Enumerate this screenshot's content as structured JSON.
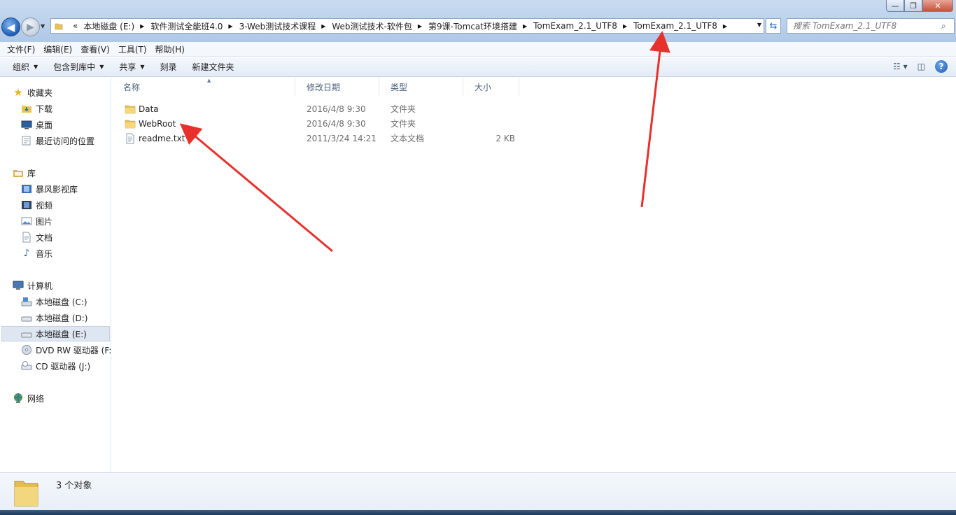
{
  "window": {
    "minimize": "—",
    "maximize": "❐",
    "close": "✕"
  },
  "address": {
    "overflow": "«",
    "crumbs": [
      "本地磁盘 (E:)",
      "软件测试全能班4.0",
      "3-Web测试技术课程",
      "Web测试技术-软件包",
      "第9课-Tomcat环境搭建",
      "TomExam_2.1_UTF8",
      "TomExam_2.1_UTF8"
    ]
  },
  "search": {
    "placeholder": "搜索 TomExam_2.1_UTF8"
  },
  "menu": {
    "file": "文件(F)",
    "edit": "编辑(E)",
    "view": "查看(V)",
    "tools": "工具(T)",
    "help": "帮助(H)"
  },
  "toolbar": {
    "organize": "组织",
    "include_library": "包含到库中",
    "share": "共享",
    "burn": "刻录",
    "new_folder": "新建文件夹"
  },
  "nav": {
    "favorites": "收藏夹",
    "downloads": "下载",
    "desktop": "桌面",
    "recent": "最近访问的位置",
    "libraries": "库",
    "storm_library": "暴风影视库",
    "videos": "视频",
    "pictures": "图片",
    "documents": "文档",
    "music": "音乐",
    "computer": "计算机",
    "disk_c": "本地磁盘 (C:)",
    "disk_d": "本地磁盘 (D:)",
    "disk_e": "本地磁盘 (E:)",
    "dvd": "DVD RW 驱动器 (F:",
    "cd": "CD 驱动器 (J:)",
    "network": "网络"
  },
  "columns": {
    "name": "名称",
    "modified": "修改日期",
    "type": "类型",
    "size": "大小"
  },
  "files": [
    {
      "name": "Data",
      "modified": "2016/4/8 9:30",
      "type": "文件夹",
      "size": "",
      "kind": "folder"
    },
    {
      "name": "WebRoot",
      "modified": "2016/4/8 9:30",
      "type": "文件夹",
      "size": "",
      "kind": "folder"
    },
    {
      "name": "readme.txt",
      "modified": "2011/3/24 14:21",
      "type": "文本文档",
      "size": "2 KB",
      "kind": "text"
    }
  ],
  "status": {
    "count": "3 个对象"
  },
  "colors": {
    "accent": "#1f5fb8",
    "annotation": "#e8302c",
    "folder": "#e8c35a"
  }
}
